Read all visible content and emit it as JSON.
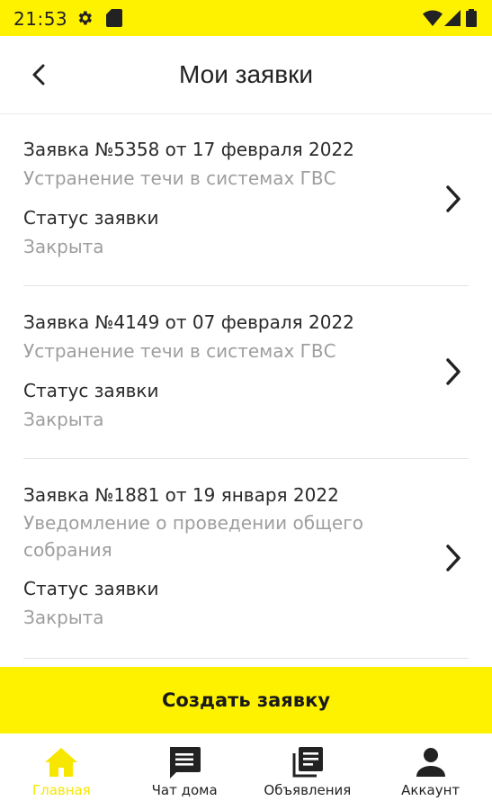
{
  "status_bar": {
    "time": "21:53"
  },
  "app_bar": {
    "title": "Мои заявки"
  },
  "requests": [
    {
      "heading": "Заявка №5358 от 17 февраля 2022",
      "description": "Устранение течи в системах ГВС",
      "status_label": "Статус заявки",
      "status_value": "Закрыта"
    },
    {
      "heading": "Заявка №4149 от 07 февраля 2022",
      "description": "Устранение течи в системах ГВС",
      "status_label": "Статус заявки",
      "status_value": "Закрыта"
    },
    {
      "heading": "Заявка №1881 от 19 января 2022",
      "description": "Уведомление о проведении общего собрания",
      "status_label": "Статус заявки",
      "status_value": "Закрыта"
    }
  ],
  "create_button": {
    "label": "Создать заявку"
  },
  "bottom_nav": [
    {
      "label": "Главная",
      "icon": "home-icon",
      "active": true
    },
    {
      "label": "Чат дома",
      "icon": "chat-icon",
      "active": false
    },
    {
      "label": "Объявления",
      "icon": "announcements-icon",
      "active": false
    },
    {
      "label": "Аккаунт",
      "icon": "account-icon",
      "active": false
    }
  ],
  "colors": {
    "accent": "#fff200",
    "active_nav": "#f7e600",
    "secondary_text": "#9e9e9e"
  }
}
